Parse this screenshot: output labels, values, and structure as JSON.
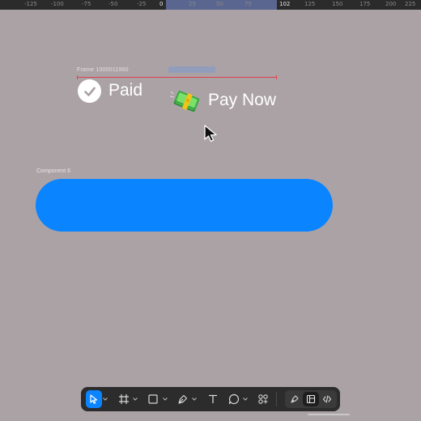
{
  "ruler": {
    "ticks": [
      "-125",
      "-100",
      "-75",
      "-50",
      "-25",
      "0",
      "25",
      "50",
      "75",
      "102",
      "125",
      "150",
      "175",
      "200",
      "225"
    ]
  },
  "canvas": {
    "frame_label": "Frame 1000011960",
    "paid_label": "Paid",
    "paynow_label": "Pay Now",
    "component_label": "Component 6"
  },
  "colors": {
    "canvas_bg": "#aba2a6",
    "pill": "#0a84ff",
    "selection": "#e0424a",
    "toolbar_bg": "#2c2c2c",
    "accent": "#0a84ff"
  },
  "toolbar": {
    "tools": [
      "move-icon",
      "frame-icon",
      "rectangle-icon",
      "pen-icon",
      "text-icon",
      "comment-icon",
      "actions-icon"
    ],
    "modes": [
      "design-mode-icon",
      "dev-mode-icon",
      "code-icon"
    ],
    "active_tool": "move-icon"
  }
}
